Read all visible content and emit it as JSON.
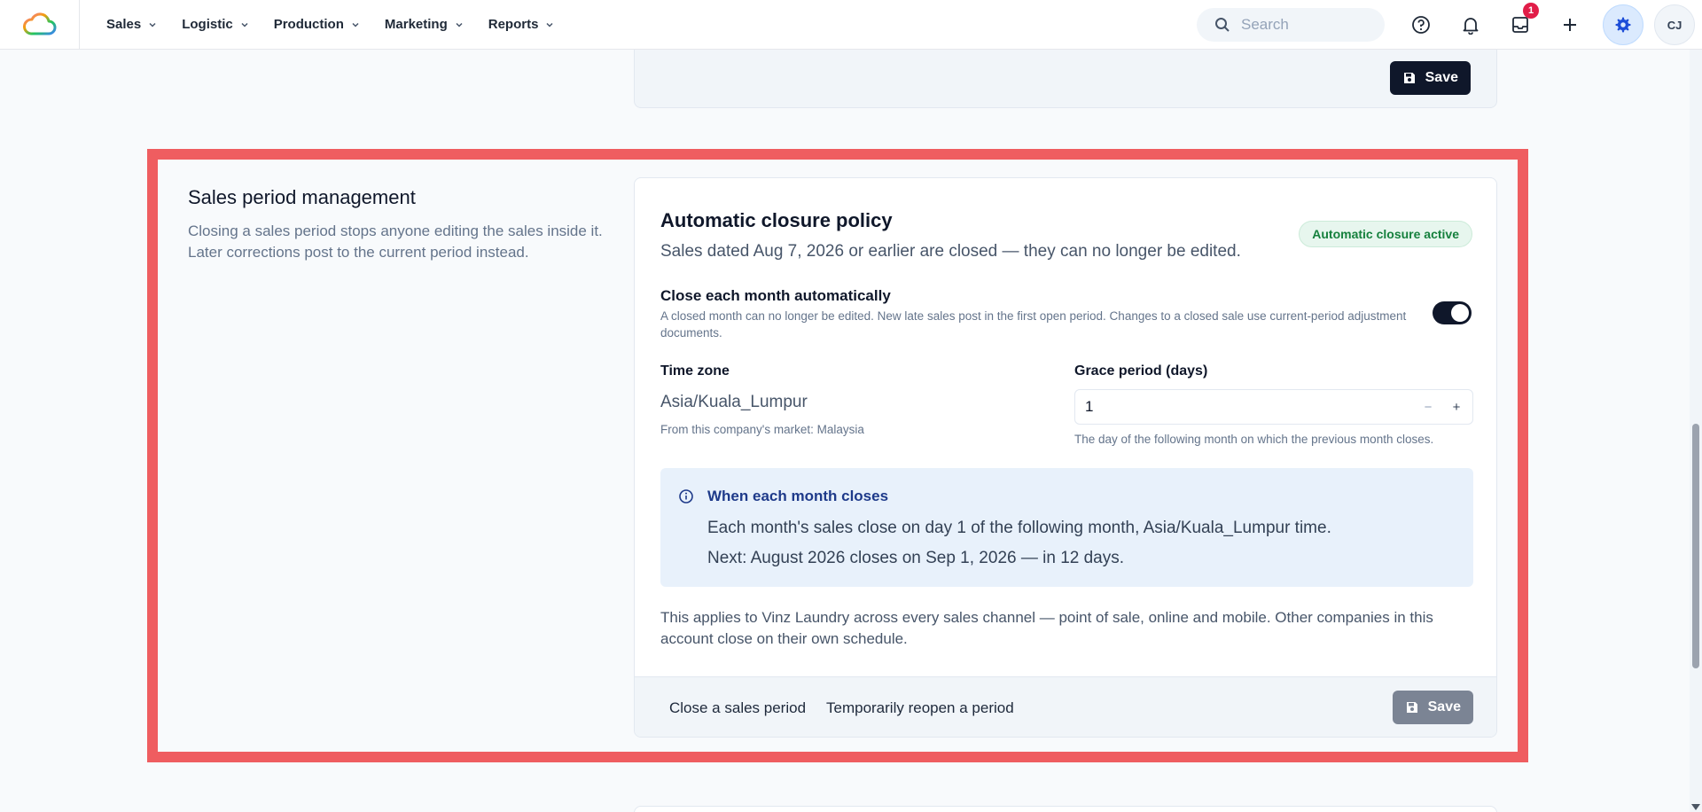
{
  "nav": {
    "menu": [
      {
        "label": "Sales"
      },
      {
        "label": "Logistic"
      },
      {
        "label": "Production"
      },
      {
        "label": "Marketing"
      },
      {
        "label": "Reports"
      }
    ],
    "search_placeholder": "Search",
    "inbox_badge": "1",
    "avatar_initials": "CJ",
    "icons": [
      "cloud-logo-icon",
      "chevron-down-icon",
      "search-icon",
      "help-icon",
      "bell-icon",
      "inbox-icon",
      "plus-icon",
      "gear-icon"
    ]
  },
  "prev_card": {
    "save_label": "Save"
  },
  "section": {
    "title": "Sales period management",
    "description": "Closing a sales period stops anyone editing the sales inside it. Later corrections post to the current period instead."
  },
  "policy": {
    "title": "Automatic closure policy",
    "status": "Automatic closure active",
    "status_color": "#15803d",
    "subtitle": "Sales dated Aug 7, 2026 or earlier are closed — they can no longer be edited.",
    "toggle_label": "Close each month automatically",
    "toggle_description": "A closed month can no longer be edited. New late sales post in the first open period. Changes to a closed sale use current-period adjustment documents.",
    "toggle_on": true,
    "timezone_label": "Time zone",
    "timezone_value": "Asia/Kuala_Lumpur",
    "timezone_hint": "From this company's market: Malaysia",
    "grace_label": "Grace period (days)",
    "grace_value": "1",
    "grace_minus": "−",
    "grace_plus": "+",
    "grace_hint": "The day of the following month on which the previous month closes.",
    "info_title": "When each month closes",
    "info_line1": "Each month's sales close on day 1 of the following month, Asia/Kuala_Lumpur time.",
    "info_line2": "Next: August 2026 closes on Sep 1, 2026 — in 12 days.",
    "apply_text": "This applies to Vinz Laundry across every sales channel — point of sale, online and mobile. Other companies in this account close on their own schedule.",
    "footer": {
      "close_link": "Close a sales period",
      "reopen_link": "Temporarily reopen a period",
      "save_label": "Save"
    }
  },
  "colors": {
    "highlight": "#ef5d60",
    "primary": "#0f172a",
    "info_bg": "#e8f1fb"
  }
}
